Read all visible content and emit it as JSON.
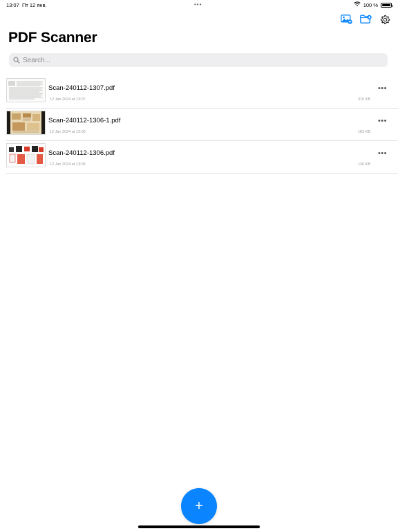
{
  "status_bar": {
    "time": "13:07",
    "date": "Пт 12 янв.",
    "battery": "100 %"
  },
  "toolbar": {
    "icons": [
      "photo-add-icon",
      "folder-add-icon",
      "gear-icon"
    ],
    "accent_color": "#0a84ff"
  },
  "page_title": "PDF Scanner",
  "search": {
    "placeholder": "Search...",
    "value": ""
  },
  "files": [
    {
      "name": "Scan-240112-1307.pdf",
      "date": "12 Jan 2024 at 13:07",
      "size": "315 KB"
    },
    {
      "name": "Scan-240112-1306-1.pdf",
      "date": "12 Jan 2024 at 13:06",
      "size": "183 KB"
    },
    {
      "name": "Scan-240112-1306.pdf",
      "date": "12 Jan 2024 at 13:06",
      "size": "130 KB"
    }
  ],
  "more_label": "•••",
  "fab": {
    "label": "+",
    "color": "#0a84ff"
  }
}
